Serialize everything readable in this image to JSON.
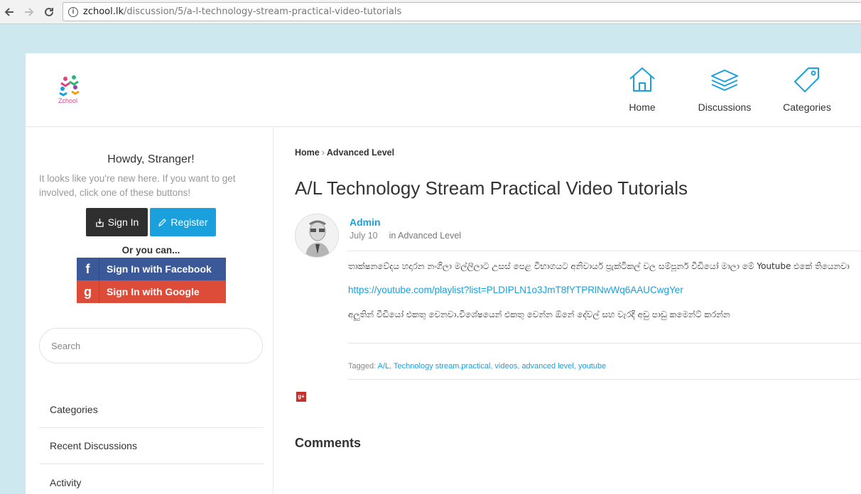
{
  "browser": {
    "url_host": "zchool.lk",
    "url_path": "/discussion/5/a-l-technology-stream-practical-video-tutorials"
  },
  "header": {
    "logo_text": "Zchool",
    "nav": [
      {
        "label": "Home",
        "icon": "home-icon"
      },
      {
        "label": "Discussions",
        "icon": "layers-icon"
      },
      {
        "label": "Categories",
        "icon": "tag-icon"
      }
    ]
  },
  "sidebar": {
    "greeting": "Howdy, Stranger!",
    "intro": "It looks like you're new here. If you want to get involved, click one of these buttons!",
    "signin_label": "Sign In",
    "register_label": "Register",
    "or_label": "Or you can...",
    "facebook_label": "Sign In with Facebook",
    "google_label": "Sign In with Google",
    "search_placeholder": "Search",
    "links": [
      "Categories",
      "Recent Discussions",
      "Activity"
    ]
  },
  "main": {
    "breadcrumb": [
      "Home",
      "Advanced Level"
    ],
    "title": "A/L Technology Stream Practical Video Tutorials",
    "author": "Admin",
    "date": "July 10",
    "category": "in Advanced Level",
    "body_line1": "තාක්ෂනවේදය හදාරන නංගිලා මල්ලිලාට උසස් පෙළ විභාගයට අනිවාර්ය ප්‍රැක්ටිකල් වල සම්පූර්න වීඩියෝ මාලා මේ Youtube එකේ තියෙනවා",
    "link": "https://youtube.com/playlist?list=PLDIPLN1o3JmT8fYTPRlNwWq6AAUCwgYer",
    "body_line3": "අලුතින් වීඩියෝ එකතු වෙනවා.විශේෂයෙන් එකතු වෙන්න ඕනේ දේවල් සහ වැරදි අඩු පාඩු කමෙන්ට් කරන්න",
    "tagged_label": "Tagged:",
    "tags": [
      "A/L",
      "Technology stream.practical",
      "videos",
      "advanced level",
      "youtube"
    ],
    "comments_heading": "Comments"
  },
  "colors": {
    "accent": "#1aa0dc",
    "facebook": "#3b5998",
    "google": "#dd4b39",
    "dark_button": "#2f2f2f"
  }
}
